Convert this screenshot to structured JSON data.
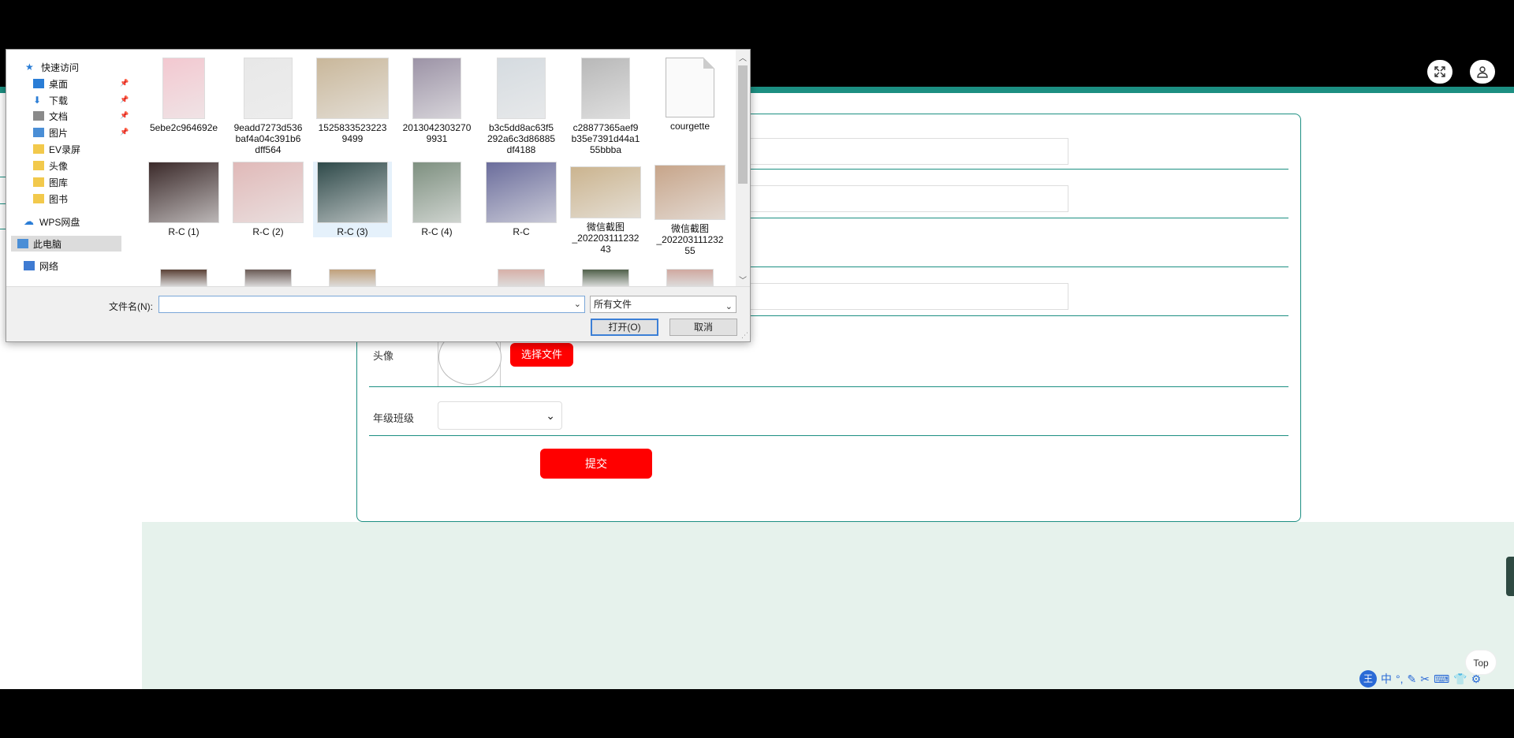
{
  "dialog": {
    "nav": [
      {
        "label": "快速访问",
        "icon": "star-icon"
      },
      {
        "label": "桌面",
        "icon": "desktop-icon",
        "pinned": true
      },
      {
        "label": "下载",
        "icon": "download-icon",
        "pinned": true
      },
      {
        "label": "文档",
        "icon": "document-icon",
        "pinned": true
      },
      {
        "label": "图片",
        "icon": "picture-icon",
        "pinned": true
      },
      {
        "label": "EV录屏",
        "icon": "folder-icon"
      },
      {
        "label": "头像",
        "icon": "folder-icon"
      },
      {
        "label": "图库",
        "icon": "folder-icon"
      },
      {
        "label": "图书",
        "icon": "folder-icon"
      },
      {
        "label": "WPS网盘",
        "icon": "cloud-icon"
      },
      {
        "label": "此电脑",
        "icon": "computer-icon",
        "selected": true
      },
      {
        "label": "网络",
        "icon": "network-icon"
      }
    ],
    "files": [
      {
        "name": "5ebe2c964692e",
        "thumb": "#f3c8d0"
      },
      {
        "name": "9eadd7273d536baf4a04c391b6dff564",
        "thumb": "#e8e8e8"
      },
      {
        "name": "15258335232239499",
        "thumb": "#c9b79a"
      },
      {
        "name": "20130423032709931",
        "thumb": "#9c93a6"
      },
      {
        "name": "b3c5dd8ac63f5292a6c3d86885df4188",
        "thumb": "#d5dbe0"
      },
      {
        "name": "c28877365aef9b35e7391d44a155bbba",
        "thumb": "#b8b8b8"
      },
      {
        "name": "courgette",
        "thumb": "doc"
      },
      {
        "name": "R-C (1)",
        "thumb": "#3b2a2a"
      },
      {
        "name": "R-C (2)",
        "thumb": "#e0b9b8"
      },
      {
        "name": "R-C (3)",
        "thumb": "#2f4a4a",
        "selected": true
      },
      {
        "name": "R-C (4)",
        "thumb": "#7e9080"
      },
      {
        "name": "R-C",
        "thumb": "#6b6d9c"
      },
      {
        "name": "微信截图_20220311123243",
        "thumb": "#cbb48f"
      },
      {
        "name": "微信截图_20220311123255",
        "thumb": "#c7a58a"
      }
    ],
    "partial_row": [
      "#5a4035",
      "#6a5a55",
      "#c0a07a",
      "#d7b0a8",
      "#50604a",
      "#d0a9a0"
    ],
    "filename_label": "文件名(N):",
    "filename_value": "",
    "filter_value": "所有文件",
    "open_label": "打开(O)",
    "cancel_label": "取消"
  },
  "form": {
    "avatar_label": "头像",
    "choose_file_label": "选择文件",
    "grade_label": "年级班级",
    "grade_value": "",
    "submit_label": "提交"
  },
  "top_button": "Top",
  "ime": {
    "logo": "王",
    "items": [
      "中",
      "°,",
      "✎",
      "✂",
      "⌨",
      "👕",
      "⚙"
    ]
  },
  "colors": {
    "accent": "#1c8f82",
    "danger": "#ff0000",
    "content_bg": "#e6f2ec"
  }
}
